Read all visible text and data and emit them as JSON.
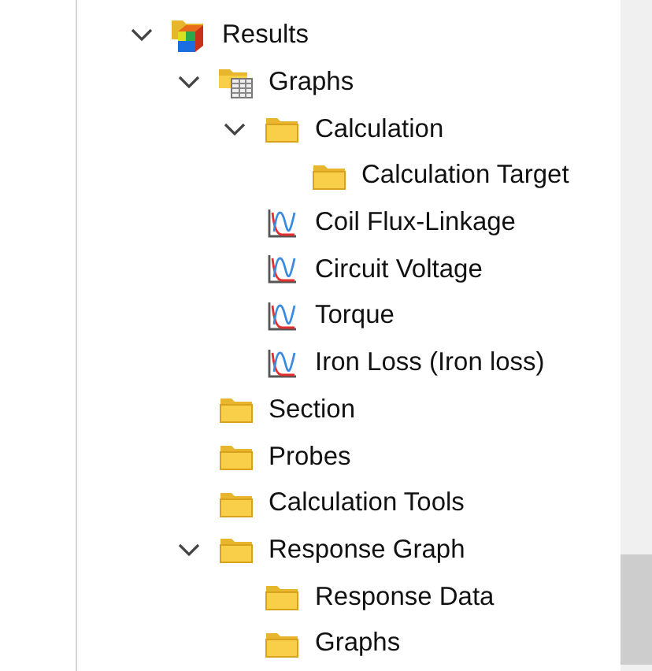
{
  "tree": [
    {
      "label": "Results",
      "kind": "results",
      "expanded": true,
      "children": [
        {
          "label": "Graphs",
          "kind": "table-folder",
          "expanded": true,
          "children": [
            {
              "label": "Calculation",
              "kind": "folder",
              "expanded": true,
              "children": [
                {
                  "label": "Calculation Target",
                  "kind": "folder"
                }
              ]
            },
            {
              "label": "Coil Flux-Linkage",
              "kind": "graph"
            },
            {
              "label": "Circuit Voltage",
              "kind": "graph"
            },
            {
              "label": "Torque",
              "kind": "graph"
            },
            {
              "label": "Iron Loss (Iron loss)",
              "kind": "graph"
            }
          ]
        },
        {
          "label": "Section",
          "kind": "folder"
        },
        {
          "label": "Probes",
          "kind": "folder"
        },
        {
          "label": "Calculation Tools",
          "kind": "folder"
        },
        {
          "label": "Response Graph",
          "kind": "folder",
          "expanded": true,
          "children": [
            {
              "label": "Response Data",
              "kind": "folder"
            },
            {
              "label": "Graphs",
              "kind": "folder"
            }
          ]
        }
      ]
    }
  ]
}
